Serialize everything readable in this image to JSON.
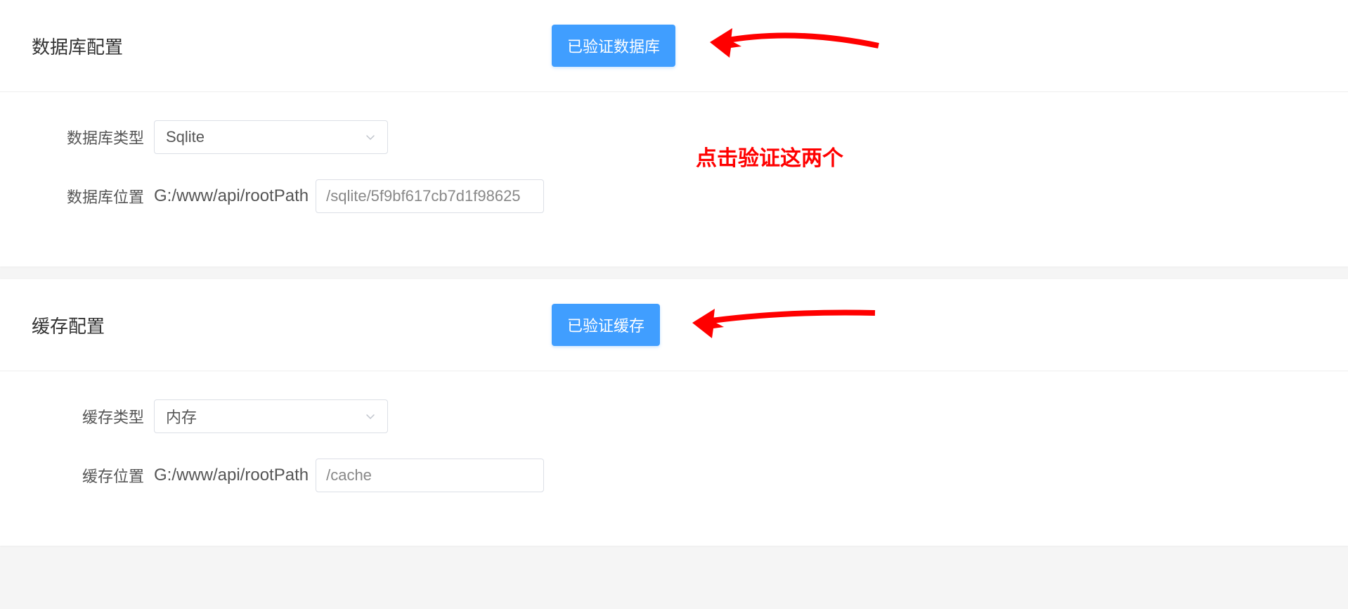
{
  "db_section": {
    "title": "数据库配置",
    "verify_label": "已验证数据库",
    "type_label": "数据库类型",
    "type_value": "Sqlite",
    "path_label": "数据库位置",
    "path_prefix": "G:/www/api/rootPath",
    "path_value": "/sqlite/5f9bf617cb7d1f98625"
  },
  "cache_section": {
    "title": "缓存配置",
    "verify_label": "已验证缓存",
    "type_label": "缓存类型",
    "type_value": "内存",
    "path_label": "缓存位置",
    "path_prefix": "G:/www/api/rootPath",
    "path_value": "/cache"
  },
  "annotation": {
    "text": "点击验证这两个"
  },
  "colors": {
    "accent": "#409eff",
    "annotation": "#ff0000"
  }
}
